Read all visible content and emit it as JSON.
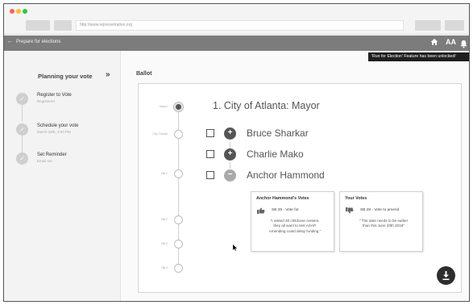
{
  "browser": {
    "url": "http://www.representation.org"
  },
  "appbar": {
    "back_glyph": "←",
    "title": "Prepare for elections",
    "home_icon": "home-icon",
    "text_size_label": "AA",
    "bell_icon": "bell-icon"
  },
  "notification": {
    "text": "'Run for Election' Feature has been unlocked!"
  },
  "sidebar": {
    "heading": "Planning your vote",
    "collapse_glyph": "»",
    "steps": [
      {
        "label": "Register to Vote",
        "sublabel": "Registered",
        "status": "done"
      },
      {
        "label": "Schedule your vote",
        "sublabel": "March 24th, 3:30 PM",
        "status": "done"
      },
      {
        "label": "Set Reminder",
        "sublabel": "Email me",
        "status": "done"
      }
    ]
  },
  "main": {
    "section_label": "Ballot",
    "timeline": [
      "Mayor",
      "City Council",
      "Bill 1",
      "Bill 2",
      "Bill 3",
      "Bill 4"
    ],
    "race_title": "1. City of Atlanta: Mayor",
    "candidates": [
      {
        "name": "Bruce Sharkar",
        "badge": "+"
      },
      {
        "name": "Charlie Mako",
        "badge": "+"
      },
      {
        "name": "Anchor Hammond",
        "badge": "−"
      }
    ],
    "candidate_votes_card": {
      "title": "Anchor Hammond's Votes",
      "row": "SB 28 - Vote for",
      "quote": "\"I visited 30 childcare centers, they all want to test ASAP. Amending could delay funding.\""
    },
    "your_votes_card": {
      "title": "Your Votes",
      "row": "SB 28 - Vote to amend",
      "quote": "\" The date needs to be earlier than this June 30th 2019\""
    }
  },
  "colors": {
    "appbar": "#7c7c7c",
    "accent_dark": "#2d2d2d",
    "step_done": "#cfcfcf",
    "tooltip_bg": "#1f1f1f"
  }
}
